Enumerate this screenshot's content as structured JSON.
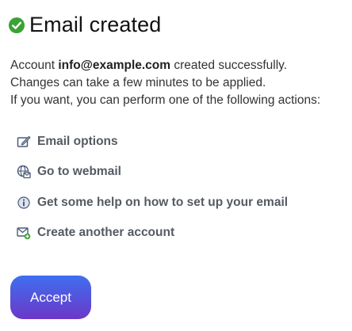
{
  "header": {
    "status_icon": "check-circle-icon",
    "status_color": "#3aa335",
    "title": "Email created"
  },
  "message": {
    "prefix": "Account ",
    "account": "info@example.com",
    "suffix": " created successfully.",
    "line2": "Changes can take a few minutes to be applied.",
    "line3": "If you want, you can perform one of the following actions:"
  },
  "actions": [
    {
      "icon": "edit-icon",
      "label": "Email options"
    },
    {
      "icon": "webmail-globe-icon",
      "label": "Go to webmail"
    },
    {
      "icon": "info-icon",
      "label": "Get some help on how to set up your email"
    },
    {
      "icon": "add-email-icon",
      "label": "Create another account"
    }
  ],
  "footer": {
    "accept_label": "Accept",
    "accept_gradient": [
      "#3f6ff0",
      "#6b38c8"
    ]
  }
}
